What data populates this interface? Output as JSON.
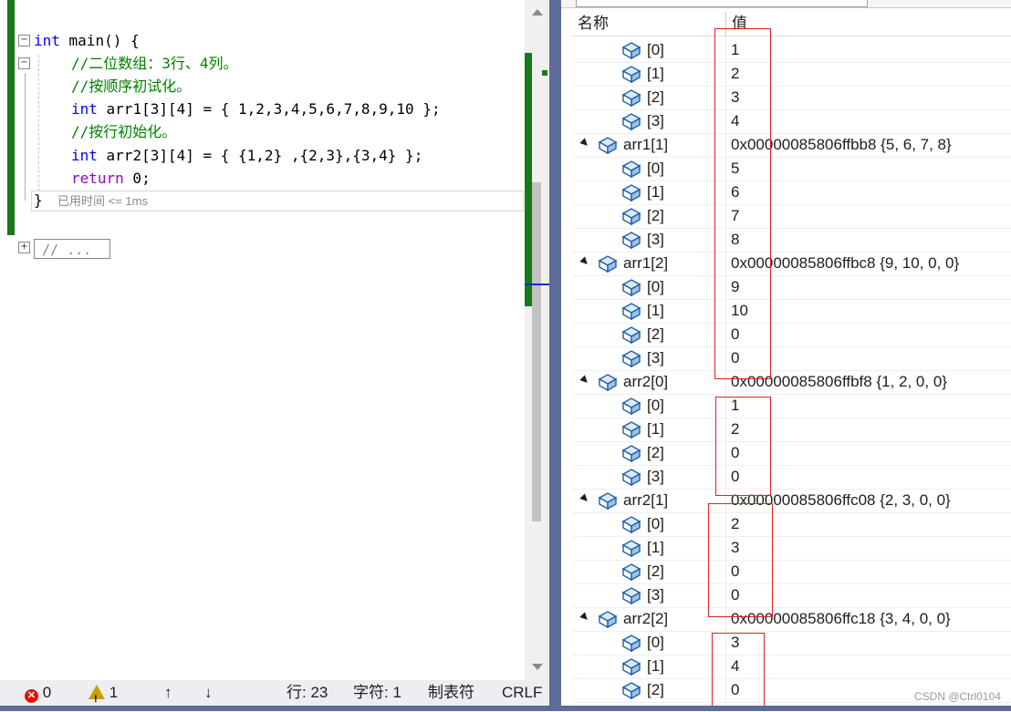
{
  "editor": {
    "lines": {
      "main_kw": "int",
      "main_rest": " main() {",
      "comment1": "//二位数组：3行、4列。",
      "comment2": "//按顺序初试化。",
      "arr1_kw": "int",
      "arr1_rest": " arr1[3][4] = { 1,2,3,4,5,6,7,8,9,10 };",
      "comment3": "//按行初始化。",
      "arr2_kw": "int",
      "arr2_rest": " arr2[3][4] = { {1,2} ,{2,3},{3,4} };",
      "return_kw": "return",
      "return_rest": " 0;",
      "close": "}"
    },
    "elapsed_hint": "已用时间 <= 1ms",
    "collapsed_region": "// ..."
  },
  "statusbar": {
    "errors": "0",
    "warnings": "1",
    "up_arrow": "↑",
    "down_arrow": "↓",
    "line": "行: 23",
    "char": "字符: 1",
    "tabs": "制表符",
    "eol": "CRLF"
  },
  "watch": {
    "header_name": "名称",
    "header_value": "值",
    "rows": [
      {
        "name": "[0]",
        "value": "1",
        "level": 2
      },
      {
        "name": "[1]",
        "value": "2",
        "level": 2
      },
      {
        "name": "[2]",
        "value": "3",
        "level": 2
      },
      {
        "name": "[3]",
        "value": "4",
        "level": 2
      },
      {
        "name": "arr1[1]",
        "value": "0x00000085806ffbb8 {5, 6, 7, 8}",
        "level": 1
      },
      {
        "name": "[0]",
        "value": "5",
        "level": 2
      },
      {
        "name": "[1]",
        "value": "6",
        "level": 2
      },
      {
        "name": "[2]",
        "value": "7",
        "level": 2
      },
      {
        "name": "[3]",
        "value": "8",
        "level": 2
      },
      {
        "name": "arr1[2]",
        "value": "0x00000085806ffbc8 {9, 10, 0, 0}",
        "level": 1
      },
      {
        "name": "[0]",
        "value": "9",
        "level": 2
      },
      {
        "name": "[1]",
        "value": "10",
        "level": 2
      },
      {
        "name": "[2]",
        "value": "0",
        "level": 2
      },
      {
        "name": "[3]",
        "value": "0",
        "level": 2
      },
      {
        "name": "arr2[0]",
        "value": "0x00000085806ffbf8 {1, 2, 0, 0}",
        "level": 1
      },
      {
        "name": "[0]",
        "value": "1",
        "level": 2
      },
      {
        "name": "[1]",
        "value": "2",
        "level": 2
      },
      {
        "name": "[2]",
        "value": "0",
        "level": 2
      },
      {
        "name": "[3]",
        "value": "0",
        "level": 2
      },
      {
        "name": "arr2[1]",
        "value": "0x00000085806ffc08 {2, 3, 0, 0}",
        "level": 1
      },
      {
        "name": "[0]",
        "value": "2",
        "level": 2
      },
      {
        "name": "[1]",
        "value": "3",
        "level": 2
      },
      {
        "name": "[2]",
        "value": "0",
        "level": 2
      },
      {
        "name": "[3]",
        "value": "0",
        "level": 2
      },
      {
        "name": "arr2[2]",
        "value": "0x00000085806ffc18 {3, 4, 0, 0}",
        "level": 1
      },
      {
        "name": "[0]",
        "value": "3",
        "level": 2
      },
      {
        "name": "[1]",
        "value": "4",
        "level": 2
      },
      {
        "name": "[2]",
        "value": "0",
        "level": 2
      }
    ]
  },
  "watermark": "CSDN @Ctrl0104",
  "colors": {
    "keyword": "#0000ff",
    "comment": "#008000",
    "return_keyword": "#8f08c4",
    "highlight_box": "#e02020",
    "splitter": "#5d6b99"
  }
}
